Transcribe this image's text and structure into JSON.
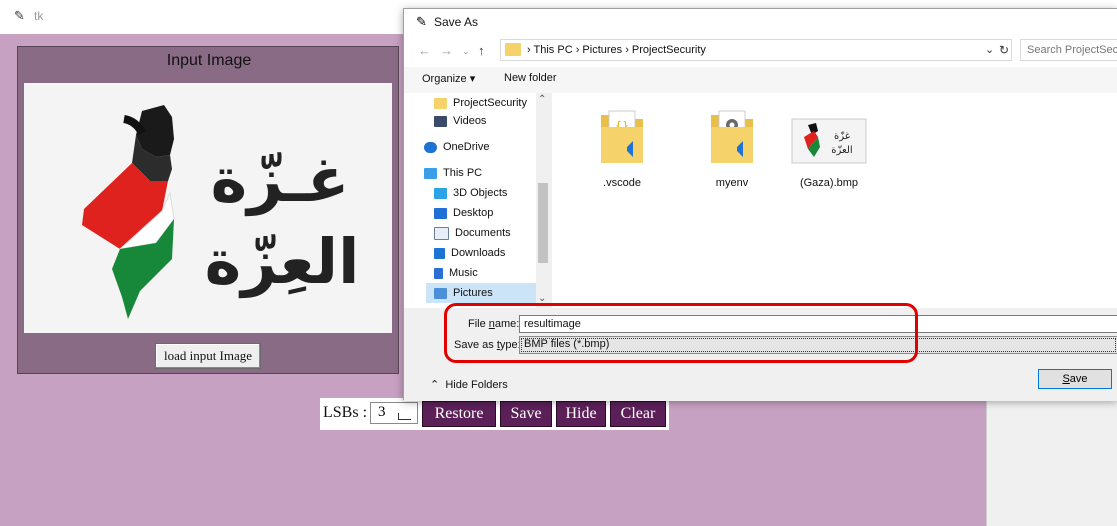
{
  "tk_window": {
    "title": "tk",
    "input_panel": {
      "title": "Input Image",
      "image_text_line1": "غـزّة",
      "image_text_line2": "العِزّة",
      "load_button": "load input Image"
    },
    "controls": {
      "lsb_label": "LSBs :",
      "lsb_value": "3",
      "restore": "Restore",
      "save": "Save",
      "hide": "Hide",
      "clear": "Clear"
    },
    "colors": {
      "background": "#c7a1c2",
      "panel": "#8a6b86",
      "button": "#5b2058"
    }
  },
  "save_dialog": {
    "title": "Save As",
    "address": "›  This PC  ›  Pictures  ›  ProjectSecurity",
    "search_placeholder": "Search ProjectSecurity",
    "organize": "Organize ▾",
    "new_folder": "New folder",
    "nav_items": [
      {
        "label": "ProjectSecurity",
        "icon": "folder-icon"
      },
      {
        "label": "Videos",
        "icon": "video-icon"
      },
      {
        "label": "OneDrive",
        "icon": "cloud-icon"
      },
      {
        "label": "This PC",
        "icon": "pc-icon"
      },
      {
        "label": "3D Objects",
        "icon": "cube-icon"
      },
      {
        "label": "Desktop",
        "icon": "desktop-icon"
      },
      {
        "label": "Documents",
        "icon": "document-icon"
      },
      {
        "label": "Downloads",
        "icon": "download-icon"
      },
      {
        "label": "Music",
        "icon": "music-icon"
      },
      {
        "label": "Pictures",
        "icon": "pictures-icon"
      }
    ],
    "files": [
      {
        "name": ".vscode",
        "icon": "folder-icon"
      },
      {
        "name": "myenv",
        "icon": "folder-icon"
      },
      {
        "name": "(Gaza).bmp",
        "icon": "image-icon"
      }
    ],
    "file_name_label_pre": "File ",
    "file_name_label_u": "n",
    "file_name_label_post": "ame:",
    "file_name_value": "resultimage",
    "type_label_pre": "Save as ",
    "type_label_u": "t",
    "type_label_post": "ype:",
    "type_value": "BMP files (*.bmp)",
    "hide_folders": "Hide Folders",
    "save_button_u": "S",
    "save_button_rest": "ave"
  }
}
